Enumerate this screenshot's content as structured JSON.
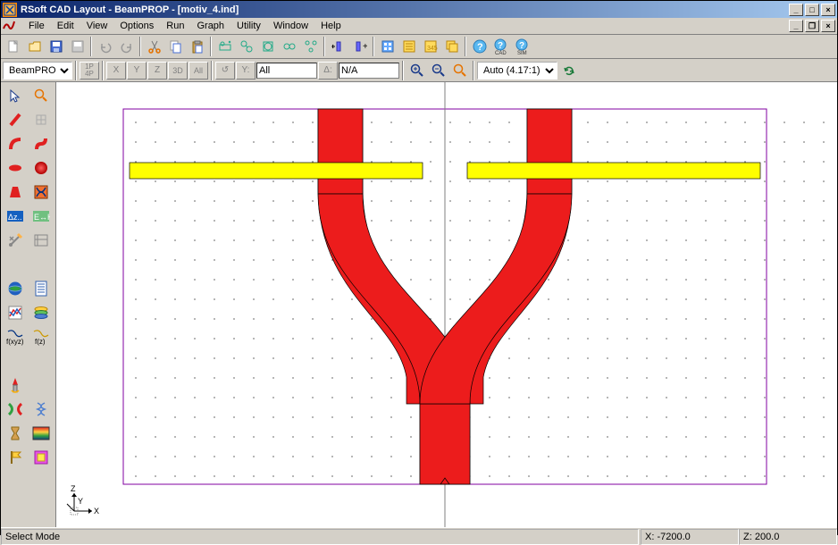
{
  "window": {
    "title": "RSoft CAD Layout - BeamPROP - [motiv_4.ind]"
  },
  "menus": [
    "File",
    "Edit",
    "View",
    "Options",
    "Run",
    "Graph",
    "Utility",
    "Window",
    "Help"
  ],
  "toolbar2": {
    "solver": "BeamPROP",
    "all_field": "All",
    "delta_field": "N/A",
    "zoom_label": "Auto (4.17:1)"
  },
  "status": {
    "mode": "Select Mode",
    "x": "X: -7200.0",
    "z": "Z: 200.0"
  },
  "axes": {
    "x": "X",
    "y": "Y",
    "z": "Z"
  }
}
